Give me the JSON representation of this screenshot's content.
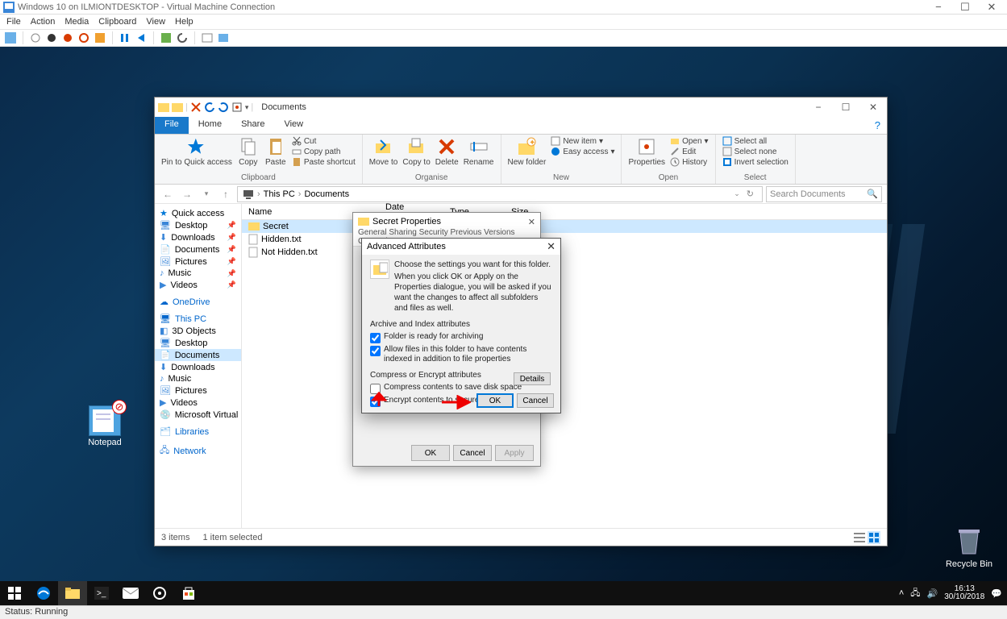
{
  "host": {
    "title": "Windows 10 on ILMIONTDESKTOP - Virtual Machine Connection",
    "menu": [
      "File",
      "Action",
      "Media",
      "Clipboard",
      "View",
      "Help"
    ],
    "status": "Status: Running"
  },
  "explorer": {
    "title": "Documents",
    "tabs": {
      "file": "File",
      "home": "Home",
      "share": "Share",
      "view": "View"
    },
    "ribbon": {
      "pin": "Pin to Quick access",
      "copy": "Copy",
      "paste": "Paste",
      "cut": "Cut",
      "copypath": "Copy path",
      "pasteshort": "Paste shortcut",
      "moveto": "Move to",
      "copyto": "Copy to",
      "delete": "Delete",
      "rename": "Rename",
      "newfolder": "New folder",
      "newitem": "New item",
      "easy": "Easy access",
      "properties": "Properties",
      "open": "Open",
      "edit": "Edit",
      "history": "History",
      "selall": "Select all",
      "selnone": "Select none",
      "invsel": "Invert selection",
      "g_clip": "Clipboard",
      "g_org": "Organise",
      "g_new": "New",
      "g_open": "Open",
      "g_sel": "Select"
    },
    "breadcrumb": [
      "This PC",
      "Documents"
    ],
    "search_placeholder": "Search Documents",
    "cols": {
      "name": "Name",
      "modified": "Date modified",
      "type": "Type",
      "size": "Size"
    },
    "rows": [
      {
        "name": "Secret",
        "sel": true,
        "icon": "folder"
      },
      {
        "name": "Hidden.txt",
        "sel": false,
        "icon": "doc"
      },
      {
        "name": "Not Hidden.txt",
        "sel": false,
        "icon": "doc"
      }
    ],
    "status": {
      "items": "3 items",
      "selected": "1 item selected"
    },
    "nav_quick": "Quick access",
    "nav_pinned": [
      "Desktop",
      "Downloads",
      "Documents",
      "Pictures",
      "Music",
      "Videos"
    ],
    "nav_onedrive": "OneDrive",
    "nav_thispc": "This PC",
    "nav_pc": [
      "3D Objects",
      "Desktop",
      "Documents",
      "Downloads",
      "Music",
      "Pictures",
      "Videos",
      "Microsoft Virtual Di"
    ],
    "nav_libs": "Libraries",
    "nav_net": "Network"
  },
  "props": {
    "title": "Secret Properties",
    "tabs": "General    Sharing    Security    Previous Versions    Customise",
    "ok": "OK",
    "cancel": "Cancel",
    "apply": "Apply"
  },
  "adv": {
    "title": "Advanced Attributes",
    "intro1": "Choose the settings you want for this folder.",
    "intro2": "When you click OK or Apply on the Properties dialogue, you will be asked if you want the changes to affect all subfolders and files as well.",
    "g1": "Archive and Index attributes",
    "c1": "Folder is ready for archiving",
    "c2": "Allow files in this folder to have contents indexed in addition to file properties",
    "g2": "Compress or Encrypt attributes",
    "c3": "Compress contents to save disk space",
    "c4": "Encrypt contents to secure data",
    "details": "Details",
    "ok": "OK",
    "cancel": "Cancel"
  },
  "desktop_icons": {
    "notepad": "Notepad",
    "recycle": "Recycle Bin"
  },
  "tray": {
    "time": "16:13",
    "date": "30/10/2018"
  }
}
